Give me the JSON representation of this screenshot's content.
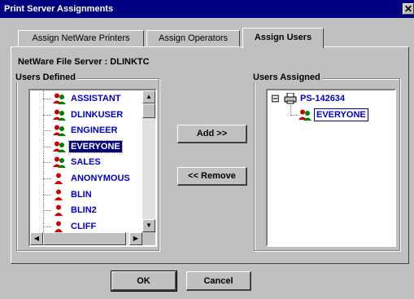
{
  "window": {
    "title": "Print Server Assignments",
    "close_glyph": "✕"
  },
  "tabs": [
    {
      "label": "Assign NetWare Printers",
      "active": false
    },
    {
      "label": "Assign Operators",
      "active": false
    },
    {
      "label": "Assign Users",
      "active": true
    }
  ],
  "server": {
    "text": "NetWare File Server : DLINKTC"
  },
  "users_defined": {
    "label": "Users Defined",
    "items": [
      {
        "name": "ASSISTANT",
        "icon": "group-icon"
      },
      {
        "name": "DLINKUSER",
        "icon": "group-icon"
      },
      {
        "name": "ENGINEER",
        "icon": "group-icon"
      },
      {
        "name": "EVERYONE",
        "icon": "group-icon",
        "selected": true
      },
      {
        "name": "SALES",
        "icon": "group-icon"
      },
      {
        "name": "ANONYMOUS",
        "icon": "user-icon"
      },
      {
        "name": "BLIN",
        "icon": "user-icon"
      },
      {
        "name": "BLIN2",
        "icon": "user-icon"
      },
      {
        "name": "CLIFF",
        "icon": "user-icon"
      }
    ]
  },
  "users_assigned": {
    "label": "Users Assigned",
    "root": {
      "name": "PS-142634",
      "expander": "⊟",
      "icon": "printer-icon"
    },
    "children": [
      {
        "name": "EVERYONE",
        "icon": "group-icon"
      }
    ]
  },
  "actions": {
    "add_label": "Add >>",
    "remove_label": "<< Remove"
  },
  "footer": {
    "ok_label": "OK",
    "cancel_label": "Cancel"
  },
  "colors": {
    "title_bg": "#000080",
    "dialog_bg": "#c0c0c0",
    "item_text": "#0000cc",
    "user_icon": "#cc0000",
    "group_icon_2": "#008000"
  }
}
